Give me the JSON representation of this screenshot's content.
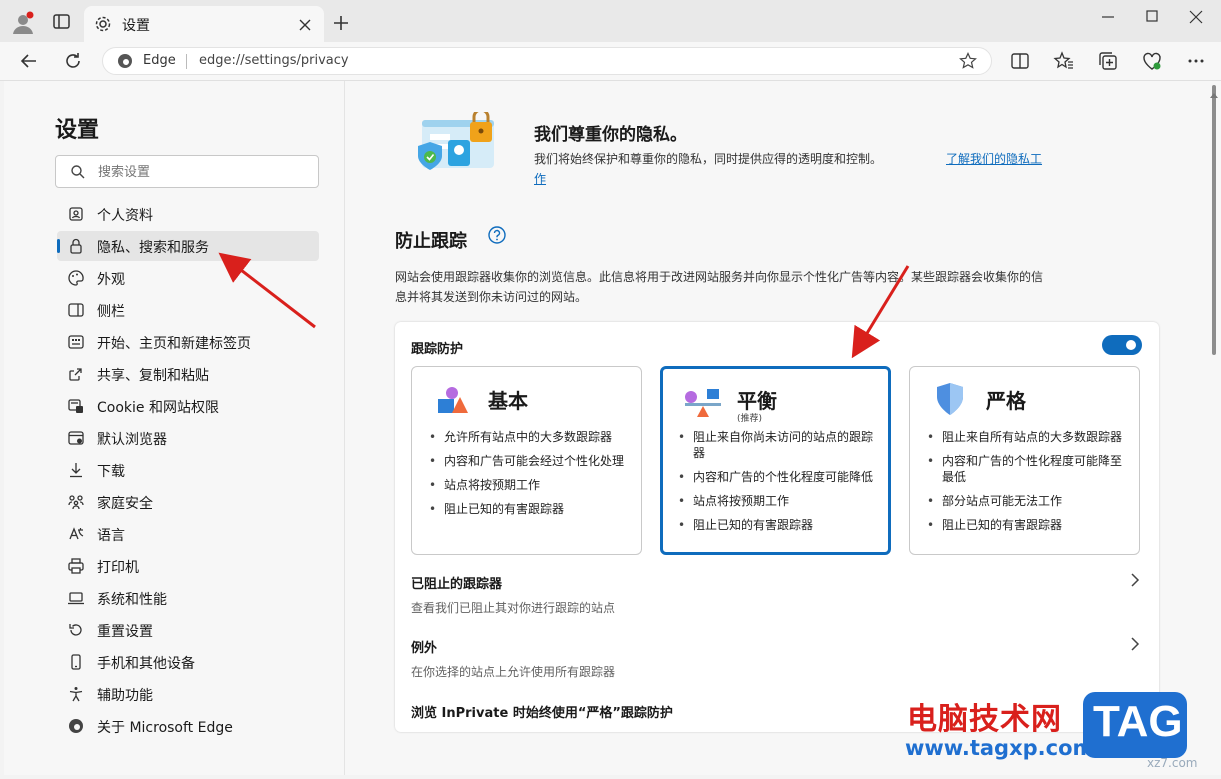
{
  "browser": {
    "tab_title": "设置",
    "site_label": "Edge",
    "url": "edge://settings/privacy"
  },
  "sidebar": {
    "title": "设置",
    "search_placeholder": "搜索设置",
    "items": [
      {
        "label": "个人资料",
        "icon": "profile-icon"
      },
      {
        "label": "隐私、搜索和服务",
        "icon": "lock-icon",
        "active": true
      },
      {
        "label": "外观",
        "icon": "palette-icon"
      },
      {
        "label": "侧栏",
        "icon": "sidebar-icon"
      },
      {
        "label": "开始、主页和新建标签页",
        "icon": "home-grid-icon"
      },
      {
        "label": "共享、复制和粘贴",
        "icon": "share-icon"
      },
      {
        "label": "Cookie 和网站权限",
        "icon": "site-permissions-icon"
      },
      {
        "label": "默认浏览器",
        "icon": "browser-icon"
      },
      {
        "label": "下载",
        "icon": "download-icon"
      },
      {
        "label": "家庭安全",
        "icon": "family-icon"
      },
      {
        "label": "语言",
        "icon": "language-icon"
      },
      {
        "label": "打印机",
        "icon": "printer-icon"
      },
      {
        "label": "系统和性能",
        "icon": "laptop-icon"
      },
      {
        "label": "重置设置",
        "icon": "reset-icon"
      },
      {
        "label": "手机和其他设备",
        "icon": "phone-icon"
      },
      {
        "label": "辅助功能",
        "icon": "accessibility-icon"
      },
      {
        "label": "关于 Microsoft Edge",
        "icon": "edge-logo-icon"
      }
    ]
  },
  "privacy_banner": {
    "title": "我们尊重你的隐私。",
    "desc": "我们将始终保护和尊重你的隐私，同时提供应得的透明度和控制。",
    "link_part1": "了解我们的隐私工",
    "link_part2": "作"
  },
  "tracking": {
    "section_title": "防止跟踪",
    "desc_line1": "网站会使用跟踪器收集你的浏览信息。此信息将用于改进网站服务并向你显示个性化广告等内容。某些跟踪器会收集你的信",
    "desc_line2": "息并将其发送到你未访问过的网站。",
    "toggle_label": "跟踪防护",
    "toggle_on": true,
    "modes": [
      {
        "title": "基本",
        "subtitle": "",
        "bullets": [
          "允许所有站点中的大多数跟踪器",
          "内容和广告可能会经过个性化处理",
          "站点将按预期工作",
          "阻止已知的有害跟踪器"
        ]
      },
      {
        "title": "平衡",
        "subtitle": "(推荐)",
        "selected": true,
        "bullets": [
          "阻止来自你尚未访问的站点的跟踪器",
          "内容和广告的个性化程度可能降低",
          "站点将按预期工作",
          "阻止已知的有害跟踪器"
        ]
      },
      {
        "title": "严格",
        "subtitle": "",
        "bullets": [
          "阻止来自所有站点的大多数跟踪器",
          "内容和广告的个性化程度可能降至最低",
          "部分站点可能无法工作",
          "阻止已知的有害跟踪器"
        ]
      }
    ],
    "blocked_title": "已阻止的跟踪器",
    "blocked_sub": "查看我们已阻止其对你进行跟踪的站点",
    "exceptions_title": "例外",
    "exceptions_sub": "在你选择的站点上允许使用所有跟踪器",
    "inprivate_title": "浏览 InPrivate 时始终使用“严格”跟踪防护"
  },
  "watermark": {
    "text_cn": "电脑技术网",
    "url": "www.tagxp.com",
    "badge": "TAG",
    "site": "xz7.com"
  },
  "colors": {
    "accent": "#0f6cbd",
    "annotation_arrow": "#d9201c",
    "watermark_red": "#d9201c",
    "watermark_blue": "#1f6fd0"
  }
}
